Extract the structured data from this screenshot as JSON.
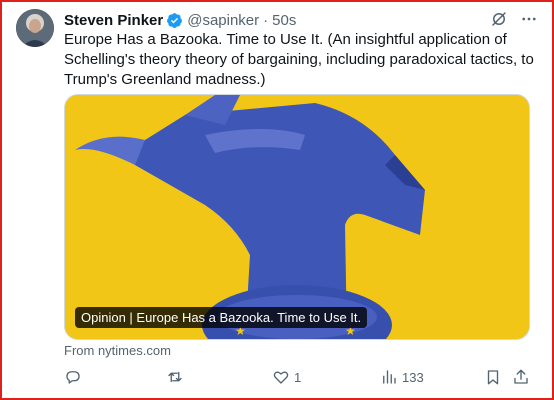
{
  "author": {
    "name": "Steven Pinker",
    "handle": "@sapinker",
    "time_sep": "·",
    "time": "50s"
  },
  "tweet": {
    "text": "Europe Has a Bazooka. Time to Use It. (An insightful application of Schelling's theory theory of bargaining, including paradoxical tactics, to Trump's Greenland madness.)"
  },
  "card": {
    "label": "Opinion | Europe Has a Bazooka. Time to Use It.",
    "source": "From nytimes.com"
  },
  "actions": {
    "replies": "",
    "retweets": "",
    "likes": "1",
    "views": "133"
  },
  "colors": {
    "frame": "#e0211b",
    "verified": "#1d9bf0",
    "card_background": "#f2c617",
    "artwork_blue": "#3e56b6"
  },
  "icons": [
    "verified-badge-icon",
    "grok-icon",
    "more-icon",
    "reply-icon",
    "retweet-icon",
    "like-icon",
    "views-icon",
    "bookmark-icon",
    "share-icon"
  ]
}
